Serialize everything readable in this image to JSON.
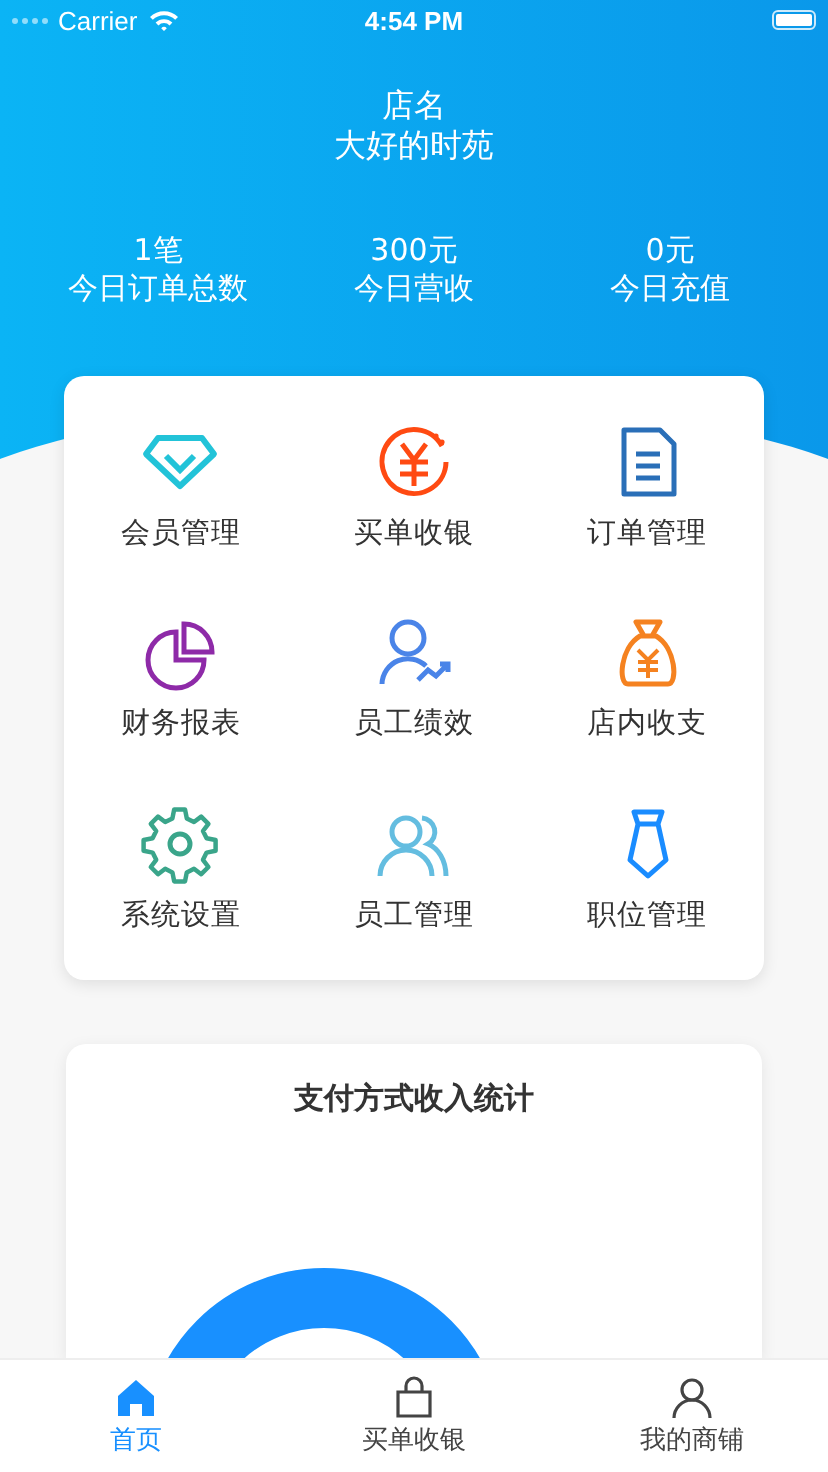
{
  "status_bar": {
    "carrier": "Carrier",
    "time": "4:54 PM"
  },
  "header": {
    "title": "店名",
    "subtitle": "大好的时苑"
  },
  "stats": [
    {
      "value": "1笔",
      "label": "今日订单总数"
    },
    {
      "value": "300元",
      "label": "今日营收"
    },
    {
      "value": "0元",
      "label": "今日充值"
    }
  ],
  "menu": [
    {
      "label": "会员管理"
    },
    {
      "label": "买单收银"
    },
    {
      "label": "订单管理"
    },
    {
      "label": "财务报表"
    },
    {
      "label": "员工绩效"
    },
    {
      "label": "店内收支"
    },
    {
      "label": "系统设置"
    },
    {
      "label": "员工管理"
    },
    {
      "label": "职位管理"
    }
  ],
  "chart_card": {
    "title": "支付方式收入统计"
  },
  "tab_bar": [
    {
      "label": "首页",
      "selected": true
    },
    {
      "label": "买单收银",
      "selected": false
    },
    {
      "label": "我的商铺",
      "selected": false
    }
  ]
}
